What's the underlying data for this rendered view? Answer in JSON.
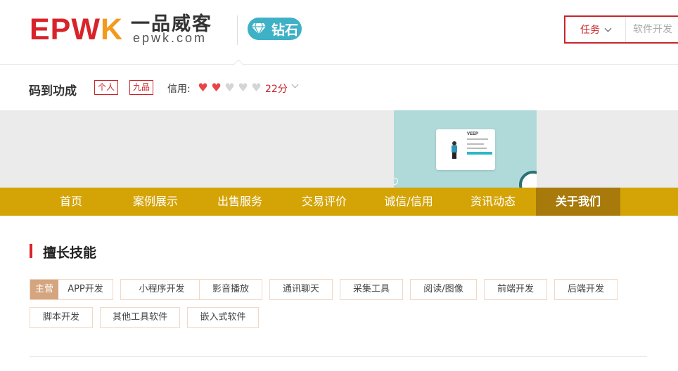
{
  "header": {
    "logo_letters": "EPW",
    "logo_k": "K",
    "logo_cn": "一品威客",
    "logo_en": "epwk.com",
    "badge_label": "钻石",
    "search_type": "任务",
    "search_placeholder": "软件开发"
  },
  "shop": {
    "name": "码到功成",
    "tag_person": "个人",
    "tag_rank": "九品",
    "credit_label": "信用:",
    "hearts_filled": 2,
    "hearts_total": 5,
    "credit_score": "22分"
  },
  "banner": {
    "card_title": "VEEP"
  },
  "nav": {
    "items": [
      {
        "label": "首页"
      },
      {
        "label": "案例展示"
      },
      {
        "label": "出售服务"
      },
      {
        "label": "交易评价"
      },
      {
        "label": "诚信/信用"
      },
      {
        "label": "资讯动态"
      },
      {
        "label": "关于我们",
        "active": true
      }
    ]
  },
  "skills": {
    "title": "擅长技能",
    "main_badge": "主营",
    "main_skill": "APP开发",
    "items": [
      "小程序开发",
      "影音播放",
      "通讯聊天",
      "采集工具",
      "阅读/图像",
      "前端开发",
      "后端开发",
      "脚本开发",
      "其他工具软件",
      "嵌入式软件"
    ]
  },
  "colors": {
    "brand_red": "#d8232a",
    "brand_orange": "#f39a1e",
    "nav_gold": "#d4a406",
    "nav_active": "#a77a0b",
    "diamond_teal": "#3eb1c7",
    "heart_filled": "#e8454a",
    "heart_empty": "#d5d5d5"
  }
}
